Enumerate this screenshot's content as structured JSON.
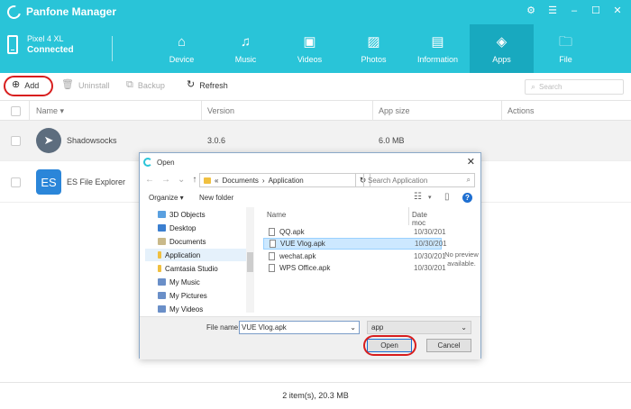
{
  "app": {
    "title": "Panfone Manager"
  },
  "device": {
    "name": "Pixel 4 XL",
    "status": "Connected"
  },
  "nav": [
    {
      "label": "Device",
      "icon": "home-icon"
    },
    {
      "label": "Music",
      "icon": "music-icon"
    },
    {
      "label": "Videos",
      "icon": "video-icon"
    },
    {
      "label": "Photos",
      "icon": "photo-icon"
    },
    {
      "label": "Information",
      "icon": "contact-card-icon"
    },
    {
      "label": "Apps",
      "icon": "apps-grid-icon",
      "active": true
    },
    {
      "label": "File",
      "icon": "folder-icon"
    }
  ],
  "toolbar": {
    "add": "Add",
    "uninstall": "Uninstall",
    "backup": "Backup",
    "refresh": "Refresh",
    "search_placeholder": "Search"
  },
  "table": {
    "headers": {
      "name": "Name",
      "version": "Version",
      "size": "App size",
      "actions": "Actions"
    },
    "rows": [
      {
        "name": "Shadowsocks",
        "version": "3.0.6",
        "size": "6.0 MB",
        "icon": "paper-plane-icon"
      },
      {
        "name": "ES File Explorer",
        "version": "",
        "size": "",
        "icon": "es-folder-icon"
      }
    ]
  },
  "footer": {
    "summary": "2 item(s), 20.3 MB"
  },
  "dialog": {
    "title": "Open",
    "address": {
      "sep": "«",
      "part1": "Documents",
      "arrow": "›",
      "part2": "Application"
    },
    "search_placeholder": "Search Application",
    "organize": "Organize ▾",
    "new_folder": "New folder",
    "tree": [
      {
        "label": "3D Objects",
        "color": "#5aa0e0"
      },
      {
        "label": "Desktop",
        "color": "#3b7fd0"
      },
      {
        "label": "Documents",
        "color": "#c9b98a"
      },
      {
        "label": "Application",
        "color": "#f0c040",
        "selected": true
      },
      {
        "label": "Camtasia Studio",
        "color": "#f0c040"
      },
      {
        "label": "My Music",
        "color": "#6a8fc8"
      },
      {
        "label": "My Pictures",
        "color": "#6a8fc8"
      },
      {
        "label": "My Videos",
        "color": "#6a8fc8"
      }
    ],
    "columns": {
      "name": "Name",
      "date": "Date moc"
    },
    "files": [
      {
        "name": "QQ.apk",
        "date": "10/30/201"
      },
      {
        "name": "VUE Vlog.apk",
        "date": "10/30/201",
        "selected": true
      },
      {
        "name": "wechat.apk",
        "date": "10/30/201"
      },
      {
        "name": "WPS Office.apk",
        "date": "10/30/201"
      }
    ],
    "preview": "No preview available.",
    "file_name_label": "File name:",
    "file_name_value": "VUE Vlog.apk",
    "file_type": "app",
    "open": "Open",
    "cancel": "Cancel"
  },
  "colors": {
    "brand": "#29c4d8",
    "brand_active": "#18a9bf",
    "highlight": "#d81e1e"
  }
}
